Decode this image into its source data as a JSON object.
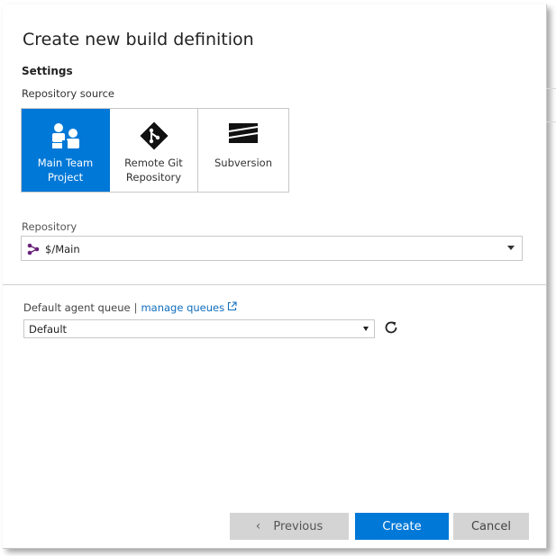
{
  "dialog": {
    "title": "Create new build definition",
    "section": "Settings"
  },
  "repository_source": {
    "label": "Repository source",
    "tiles": [
      {
        "label_line1": "Main Team",
        "label_line2": "Project",
        "icon": "team-project-icon",
        "selected": true
      },
      {
        "label_line1": "Remote Git",
        "label_line2": "Repository",
        "icon": "git-icon",
        "selected": false
      },
      {
        "label_line1": "Subversion",
        "label_line2": "",
        "icon": "subversion-icon",
        "selected": false
      }
    ]
  },
  "repository": {
    "label": "Repository",
    "value": "$/Main",
    "icon": "tfvc-branch-icon"
  },
  "agent_queue": {
    "label": "Default agent queue",
    "separator": "|",
    "link": "manage queues",
    "value": "Default"
  },
  "buttons": {
    "previous": "Previous",
    "create": "Create",
    "cancel": "Cancel"
  },
  "colors": {
    "accent": "#0078d7",
    "link": "#106ebe",
    "button_gray": "#d4d4d4"
  }
}
